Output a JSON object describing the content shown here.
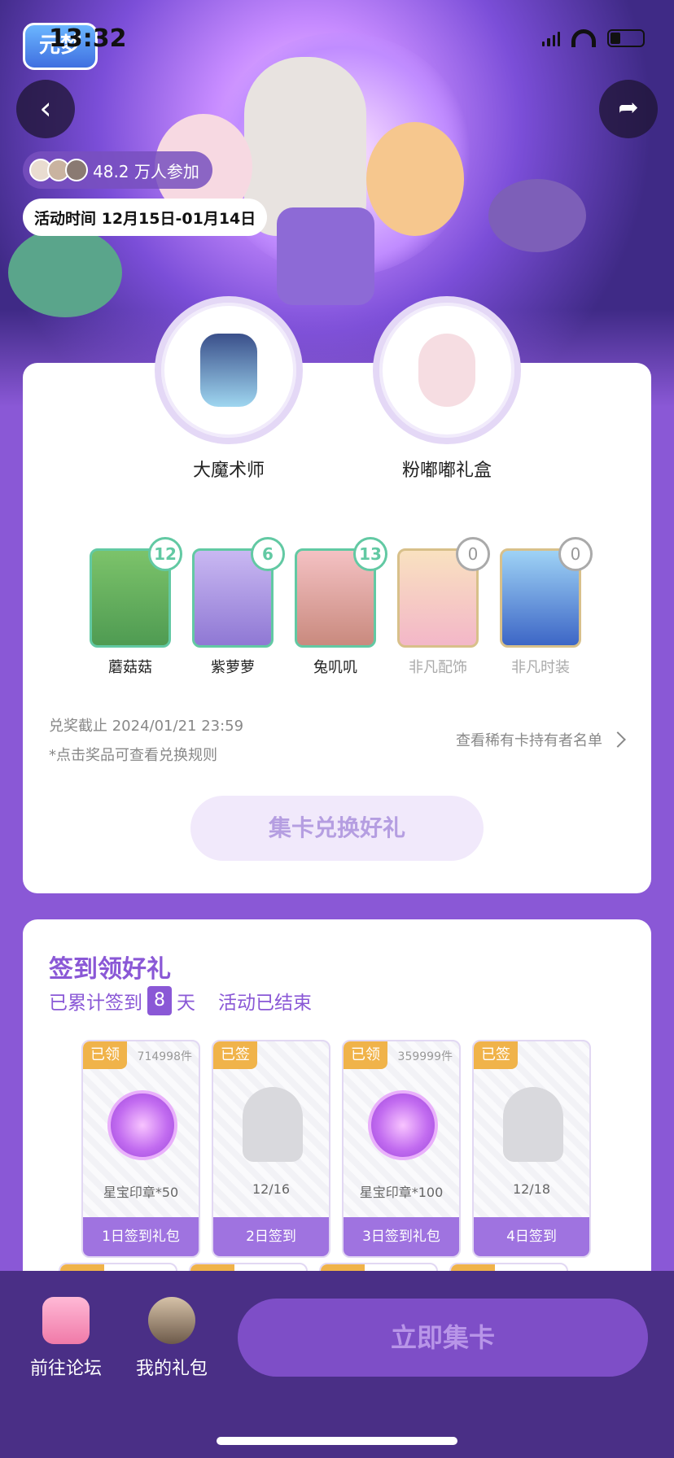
{
  "status_bar": {
    "time": "13:32"
  },
  "header": {
    "logo_text": "元梦",
    "participants": "48.2 万人参加",
    "event_time": "活动时间 12月15日-01月14日"
  },
  "prizes": [
    {
      "name": "大魔术师"
    },
    {
      "name": "粉嘟嘟礼盒"
    }
  ],
  "cards": [
    {
      "name": "蘑菇菇",
      "count": "12"
    },
    {
      "name": "紫萝萝",
      "count": "6"
    },
    {
      "name": "兔叽叽",
      "count": "13"
    },
    {
      "name": "非凡配饰",
      "count": "0"
    },
    {
      "name": "非凡时装",
      "count": "0"
    }
  ],
  "exchange": {
    "deadline": "兑奖截止 2024/01/21 23:59",
    "note": "*点击奖品可查看兑换规则",
    "holders_link": "查看稀有卡持有者名单",
    "button": "集卡兑换好礼"
  },
  "checkin": {
    "title": "签到领好礼",
    "sub_prefix": "已累计签到",
    "days": "8",
    "sub_suffix": "天",
    "status": "活动已结束",
    "items": [
      {
        "tag": "已领",
        "qty": "714998件",
        "label": "星宝印章*50",
        "button": "1日签到礼包"
      },
      {
        "tag": "已签",
        "qty": "",
        "label": "12/16",
        "button": "2日签到"
      },
      {
        "tag": "已领",
        "qty": "359999件",
        "label": "星宝印章*100",
        "button": "3日签到礼包"
      },
      {
        "tag": "已签",
        "qty": "",
        "label": "12/18",
        "button": "4日签到"
      }
    ]
  },
  "bottom_bar": {
    "forum": "前往论坛",
    "my_gifts": "我的礼包",
    "collect": "立即集卡"
  },
  "colors": {
    "accent": "#8a58d6",
    "card_border": "#62c9a3",
    "tag": "#f0b34a"
  }
}
